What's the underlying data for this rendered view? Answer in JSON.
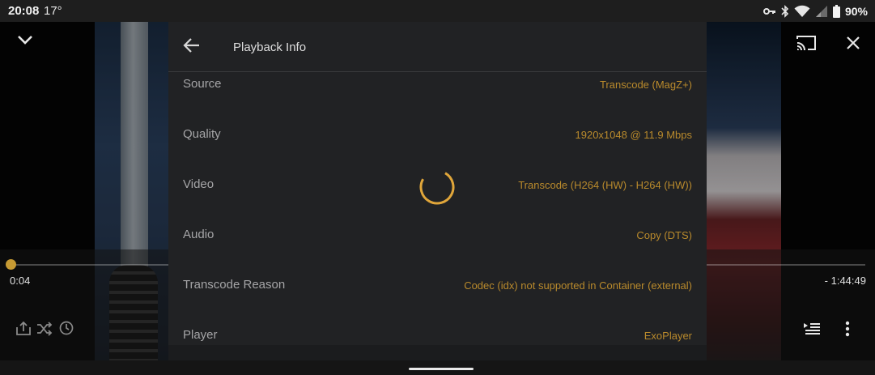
{
  "status_bar": {
    "time": "20:08",
    "temperature": "17°",
    "battery_percent": "90%",
    "icons": [
      "key-icon",
      "bluetooth-icon",
      "wifi-icon",
      "cell-signal-icon",
      "battery-icon"
    ]
  },
  "player": {
    "elapsed": "0:04",
    "remaining": "- 1:44:49",
    "progress_fraction": 0.0007,
    "accent_color": "#c69a33",
    "top_icons": [
      "chevron-down-icon",
      "cast-icon",
      "close-icon"
    ],
    "bottom_left_icons": [
      "share-icon",
      "shuffle-icon",
      "history-icon"
    ],
    "bottom_right_icons": [
      "playlist-icon",
      "more-vert-icon"
    ]
  },
  "panel": {
    "title": "Playback Info",
    "back_icon": "arrow-back-icon",
    "value_color": "#b98a2c",
    "rows": [
      {
        "label": "Source",
        "value": "Transcode (MagZ+)"
      },
      {
        "label": "Quality",
        "value": "1920x1048 @ 11.9 Mbps"
      },
      {
        "label": "Video",
        "value": "Transcode (H264 (HW) - H264 (HW))"
      },
      {
        "label": "Audio",
        "value": "Copy (DTS)"
      },
      {
        "label": "Transcode Reason",
        "value": "Codec (idx) not supported in Container (external)"
      },
      {
        "label": "Player",
        "value": "ExoPlayer"
      }
    ]
  }
}
